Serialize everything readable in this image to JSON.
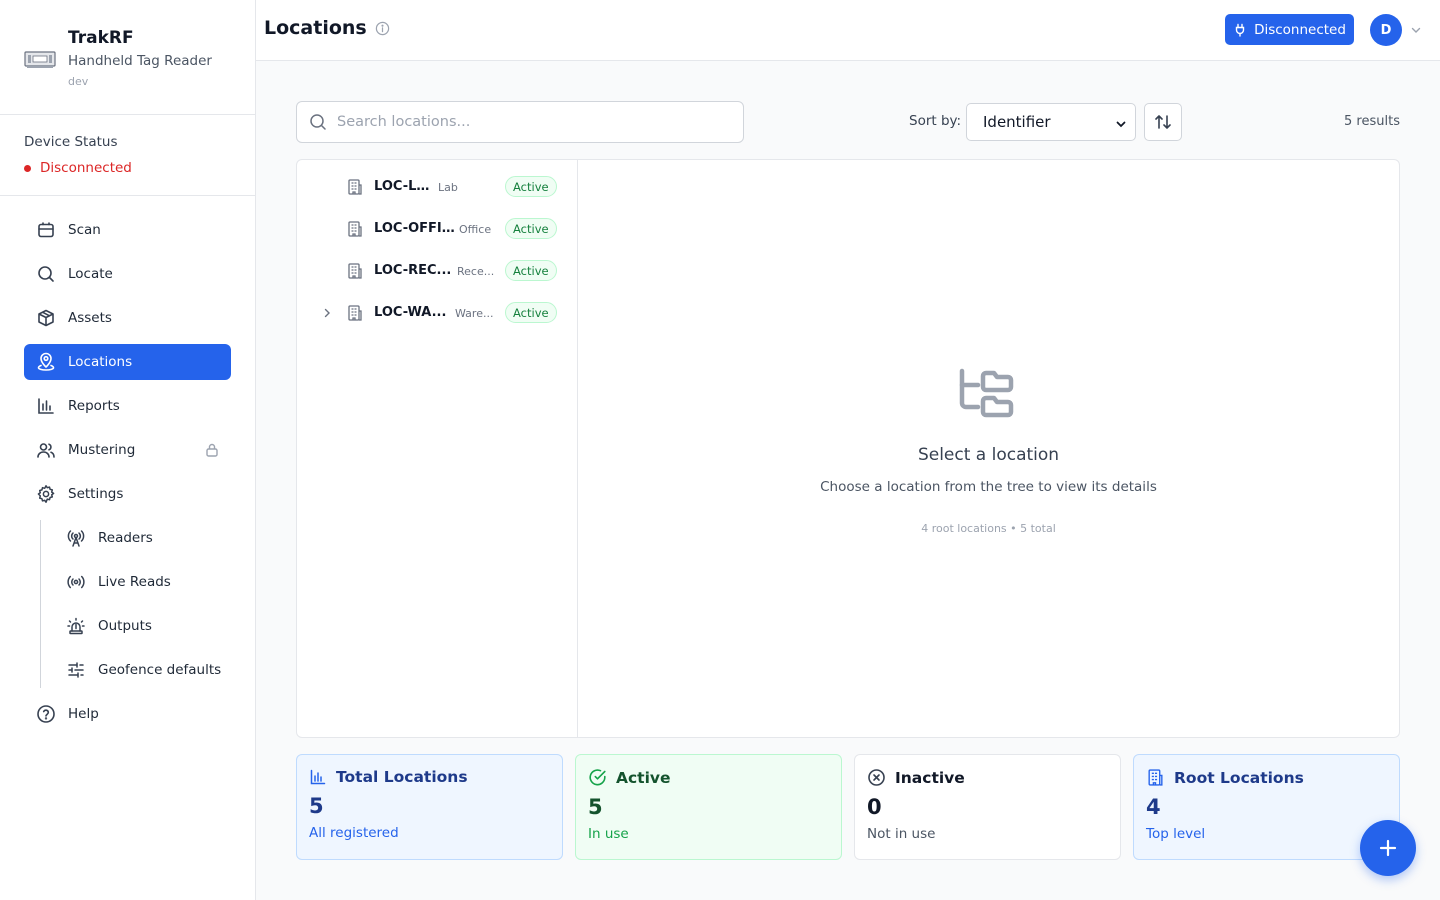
{
  "app": {
    "name": "TrakRF",
    "subtitle": "Handheld Tag Reader",
    "env": "dev"
  },
  "device_status": {
    "label": "Device Status",
    "value": "Disconnected",
    "color": "#dc2626"
  },
  "sidebar": {
    "items": [
      {
        "label": "Scan",
        "icon": "scan-icon"
      },
      {
        "label": "Locate",
        "icon": "search-icon"
      },
      {
        "label": "Assets",
        "icon": "box-icon"
      },
      {
        "label": "Locations",
        "icon": "map-pin-icon",
        "active": true
      },
      {
        "label": "Reports",
        "icon": "bar-chart-icon"
      },
      {
        "label": "Mustering",
        "icon": "users-icon",
        "locked": true
      },
      {
        "label": "Settings",
        "icon": "gear-icon"
      }
    ],
    "settings_items": [
      {
        "label": "Readers",
        "icon": "antenna-icon"
      },
      {
        "label": "Live Reads",
        "icon": "radio-icon"
      },
      {
        "label": "Outputs",
        "icon": "siren-icon"
      },
      {
        "label": "Geofence defaults",
        "icon": "sliders-icon"
      }
    ],
    "help": {
      "label": "Help",
      "icon": "help-circle-icon"
    }
  },
  "header": {
    "title": "Locations",
    "connection_button": "Disconnected",
    "avatar_initial": "D"
  },
  "toolbar": {
    "search_placeholder": "Search locations...",
    "sort_label": "Sort by:",
    "sort_value": "Identifier",
    "results": "5 results"
  },
  "tree": [
    {
      "code": "LOC-LAB",
      "type": "Lab",
      "status": "Active",
      "expandable": false
    },
    {
      "code": "LOC-OFFICE",
      "type": "Office",
      "status": "Active",
      "expandable": false
    },
    {
      "code": "LOC-REC...",
      "type": "Rece...",
      "status": "Active",
      "expandable": false
    },
    {
      "code": "LOC-WA...",
      "type": "Ware...",
      "status": "Active",
      "expandable": true
    }
  ],
  "empty_state": {
    "title": "Select a location",
    "description": "Choose a location from the tree to view its details",
    "meta": "4 root locations • 5 total"
  },
  "stats": [
    {
      "title": "Total Locations",
      "value": "5",
      "sub": "All registered",
      "theme": "blue",
      "icon": "bar-chart-icon"
    },
    {
      "title": "Active",
      "value": "5",
      "sub": "In use",
      "theme": "green",
      "icon": "check-circle-icon"
    },
    {
      "title": "Inactive",
      "value": "0",
      "sub": "Not in use",
      "theme": "gray",
      "icon": "x-circle-icon"
    },
    {
      "title": "Root Locations",
      "value": "4",
      "sub": "Top level",
      "theme": "blue",
      "icon": "building-icon"
    }
  ],
  "colors": {
    "accent": "#2563eb",
    "success": "#16a34a",
    "danger": "#dc2626"
  }
}
